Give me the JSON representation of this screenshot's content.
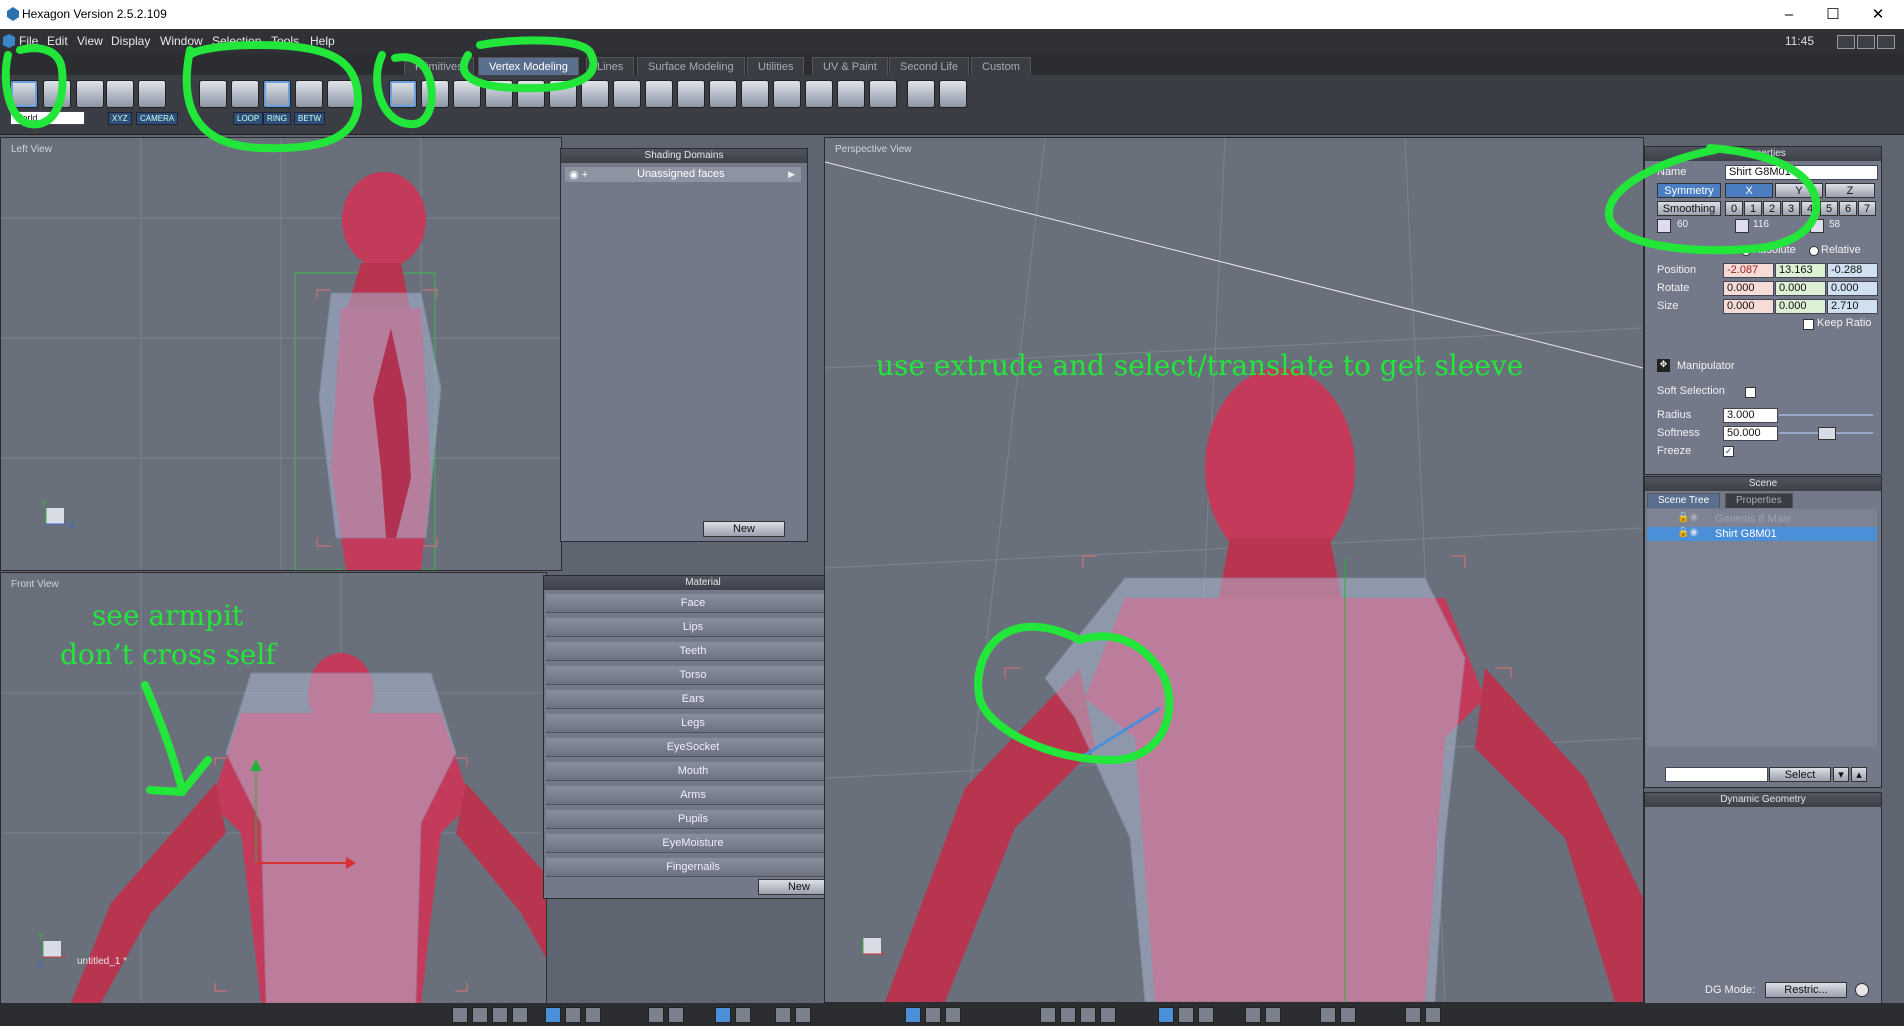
{
  "window": {
    "title": "Hexagon Version 2.5.2.109",
    "minimize": "–",
    "maximize": "☐",
    "close": "✕"
  },
  "menu": [
    "File",
    "Edit",
    "View",
    "Display",
    "Window",
    "Selection",
    "Tools",
    "Help"
  ],
  "clock": "11:45",
  "tabs": [
    "Primitives",
    "Vertex Modeling",
    "Lines",
    "Surface Modeling",
    "Utilities",
    "UV & Paint",
    "Second Life",
    "Custom"
  ],
  "toolbar": {
    "mode_select": "World",
    "xyz": "XYZ",
    "camera": "CAMERA",
    "loop": "LOOP",
    "ring": "RING",
    "betw": "BETW"
  },
  "left_view": {
    "label": "Left View",
    "axis_y": "Y",
    "axis_z": "Z"
  },
  "front_view": {
    "label": "Front View",
    "axis_y": "Y",
    "axis_x": "X",
    "file_label": "untitled_1 *"
  },
  "perspective_view": {
    "label": "Perspective View"
  },
  "shading_domains": {
    "title": "Shading Domains",
    "item": "Unassigned faces",
    "new_button": "New"
  },
  "material": {
    "title": "Material",
    "items": [
      "Face",
      "Lips",
      "Teeth",
      "Torso",
      "Ears",
      "Legs",
      "EyeSocket",
      "Mouth",
      "Arms",
      "Pupils",
      "EyeMoisture",
      "Fingernails"
    ],
    "new_button": "New"
  },
  "properties": {
    "title": "Properties",
    "name_label": "Name",
    "name_value": "Shirt G8M01",
    "symmetry_label": "Symmetry",
    "sym_x": "X",
    "sym_y": "Y",
    "sym_z": "Z",
    "smoothing_label": "Smoothing",
    "smoothing_levels": [
      "0",
      "1",
      "2",
      "3",
      "4",
      "5",
      "6",
      "7"
    ],
    "count_1": "60",
    "count_2": "116",
    "count_3": "58",
    "absolute": "Absolute",
    "relative": "Relative",
    "position_label": "Position",
    "position": [
      "-2.087",
      "13.163",
      "-0.288"
    ],
    "rotate_label": "Rotate",
    "rotate": [
      "0.000",
      "0.000",
      "0.000"
    ],
    "size_label": "Size",
    "size": [
      "0.000",
      "0.000",
      "2.710"
    ],
    "keep_ratio": "Keep Ratio",
    "manipulator": "Manipulator",
    "soft_selection": "Soft Selection",
    "radius_label": "Radius",
    "radius": "3.000",
    "softness_label": "Softness",
    "softness": "50.000",
    "freeze_label": "Freeze"
  },
  "scene": {
    "title": "Scene",
    "tab_tree": "Scene Tree",
    "tab_props": "Properties",
    "items": [
      "Genesis 8 Male",
      "Shirt G8M01"
    ],
    "select_button": "Select"
  },
  "dynamic_geometry": {
    "title": "Dynamic Geometry",
    "dg_mode_label": "DG Mode:",
    "dg_mode_value": "Restric..."
  },
  "annotations": {
    "sleeve": "use extrude and select/translate to get sleeve",
    "armpit_1": "see armpit",
    "armpit_2": "don’t cross self"
  },
  "colors": {
    "annotation": "#22e63a",
    "mesh": "#c43a5a",
    "selection": "#4a8fd8",
    "viewport": "#6a707b"
  }
}
